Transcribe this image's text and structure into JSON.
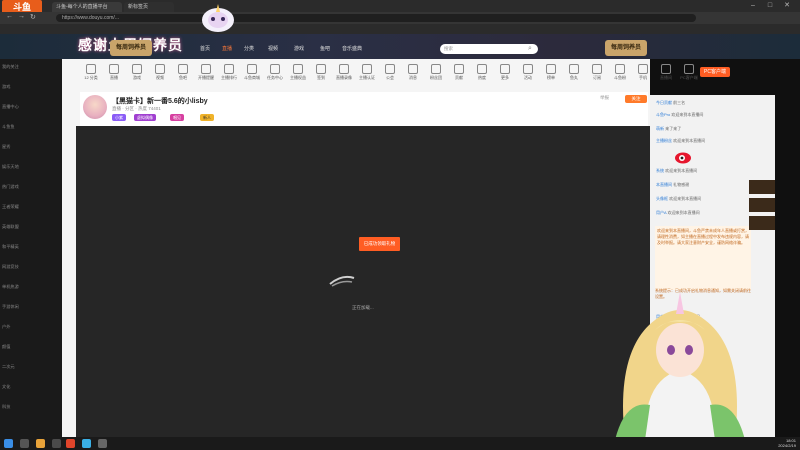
{
  "browser": {
    "tabs": [
      {
        "label": "斗鱼-每个人的直播平台"
      },
      {
        "label": "新标签页"
      }
    ],
    "url": "https://www.douyu.com/..."
  },
  "header": {
    "logo_text": "斗鱼",
    "banner_title": "感谢土周饲养员",
    "banner_sub": "每周饲养员",
    "nav": [
      "首页",
      "直播",
      "分类",
      "视频",
      "游戏",
      "鱼吧",
      "音乐盛典"
    ],
    "active_nav": "直播",
    "search_placeholder": "搜索"
  },
  "sidebar": {
    "items": [
      "我的关注",
      "游戏",
      "直播中心",
      "斗鱼鱼",
      "星秀",
      "娱乐天地",
      "热门游戏",
      "王者荣耀",
      "英雄联盟",
      "和平精英",
      "网游竞技",
      "单机热游",
      "手游休闲",
      "户外",
      "颜值",
      "二次元",
      "文化",
      "科技"
    ]
  },
  "categories": [
    "12 分类",
    "直播",
    "游戏",
    "视频",
    "鱼吧",
    "开播提醒",
    "主播排行",
    "斗鱼商城",
    "任务中心",
    "主播权益",
    "签到",
    "直播录像",
    "主播认证",
    "公会",
    "消息",
    "粉丝团",
    "贡献",
    "热度",
    "更多",
    "活动",
    "榜单",
    "鱼丸",
    "订阅",
    "斗鱼粉",
    "手机",
    "直播间",
    "PC客户端"
  ],
  "pc_app": "PC客户端",
  "room": {
    "title": "【黑猫卡】新一番5.6的小lisby",
    "meta": "直播 · 分区 · 热度 74401",
    "tags": [
      "小紫",
      "虚拟偶像",
      "唱见",
      "新人"
    ],
    "follow": "关注",
    "report": "举报"
  },
  "player": {
    "gift_button": "已成功领取礼物",
    "loading_text": "正在加载..."
  },
  "chat": {
    "lines": [
      {
        "name": "今日贡献",
        "text": "前三名"
      },
      {
        "name": "斗鱼Pro",
        "text": "欢迎来到本直播间"
      },
      {
        "name": "萌新",
        "text": "来了来了"
      },
      {
        "name": "主播粉丝",
        "text": "欢迎来到本直播间"
      },
      {
        "name": "系统",
        "text": "欢迎来到本直播间"
      },
      {
        "name": "本直播间",
        "text": "礼物感谢"
      },
      {
        "name": "头像框",
        "text": "欢迎来到本直播间"
      },
      {
        "name": "用户A",
        "text": "欢迎来到本直播间"
      },
      {
        "name": "用户B",
        "text": "欢迎来到本直播间"
      }
    ],
    "notice": "欢迎来到本直播间，斗鱼严禁未成年人直播或打赏，请理性消费，如主播在直播过程中发布违规内容，请及时举报。请大家注意财产安全，谨防网络诈骗。",
    "notice2": "系统提示：已成功开启礼物消息通知，如需关闭请前往设置。"
  },
  "taskbar": {
    "time": "18:01",
    "date": "2024/2/19"
  },
  "colors": {
    "accent": "#ff5d23",
    "header_bg": "#1c2c3a",
    "player_bg": "#262626"
  }
}
